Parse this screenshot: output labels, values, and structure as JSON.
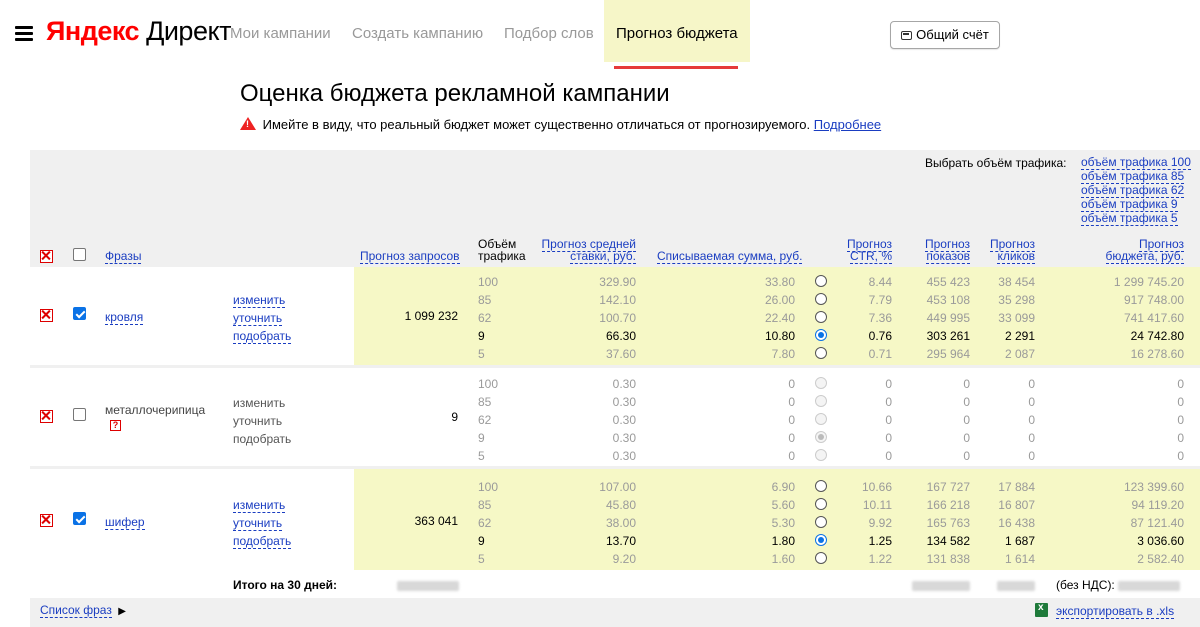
{
  "header": {
    "logo_yandex": "Яндекс",
    "logo_direct": "Директ",
    "nav": [
      "Мои кампании",
      "Создать кампанию",
      "Подбор слов",
      "Прогноз бюджета"
    ],
    "account_button": "Общий счёт"
  },
  "page": {
    "title": "Оценка бюджета рекламной кампании",
    "warning": "Имейте в виду, что реальный бюджет может существенно отличаться от прогнозируемого.",
    "warning_link": "Подробнее"
  },
  "traffic": {
    "label": "Выбрать объём трафика:",
    "options": [
      "объём трафика 100",
      "объём трафика 85",
      "объём трафика 62",
      "объём трафика 9",
      "объём трафика 5"
    ]
  },
  "columns": {
    "phrases": "Фразы",
    "requests": "Прогноз запросов",
    "traffic_1": "Объём",
    "traffic_2": "трафика",
    "bid_1": "Прогноз средней",
    "bid_2": "ставки, руб.",
    "charge": "Списываемая сумма, руб.",
    "ctr_1": "Прогноз",
    "ctr_2": "CTR, %",
    "impr_1": "Прогноз",
    "impr_2": "показов",
    "clicks_1": "Прогноз",
    "clicks_2": "кликов",
    "budget_1": "Прогноз",
    "budget_2": "бюджета, руб."
  },
  "actions": [
    "изменить",
    "уточнить",
    "подобрать"
  ],
  "rows": [
    {
      "phrase": "кровля",
      "requests": "1 099 232",
      "checked": true,
      "volumes": [
        "100",
        "85",
        "62",
        "9",
        "5"
      ],
      "bids": [
        "329.90",
        "142.10",
        "100.70",
        "66.30",
        "37.60"
      ],
      "charges": [
        "33.80",
        "26.00",
        "22.40",
        "10.80",
        "7.80"
      ],
      "ctr": [
        "8.44",
        "7.79",
        "7.36",
        "0.76",
        "0.71"
      ],
      "impressions": [
        "455 423",
        "453 108",
        "449 995",
        "303 261",
        "295 964"
      ],
      "clicks": [
        "38 454",
        "35 298",
        "33 099",
        "2 291",
        "2 087"
      ],
      "budget": [
        "1 299 745.20",
        "917 748.00",
        "741 417.60",
        "24 742.80",
        "16 278.60"
      ],
      "selected": 3
    },
    {
      "phrase": "металлочерипица",
      "requests": "9",
      "checked": false,
      "volumes": [
        "100",
        "85",
        "62",
        "9",
        "5"
      ],
      "bids": [
        "0.30",
        "0.30",
        "0.30",
        "0.30",
        "0.30"
      ],
      "charges": [
        "0",
        "0",
        "0",
        "0",
        "0"
      ],
      "ctr": [
        "0",
        "0",
        "0",
        "0",
        "0"
      ],
      "impressions": [
        "0",
        "0",
        "0",
        "0",
        "0"
      ],
      "clicks": [
        "0",
        "0",
        "0",
        "0",
        "0"
      ],
      "budget": [
        "0",
        "0",
        "0",
        "0",
        "0"
      ],
      "selected": 3
    },
    {
      "phrase": "шифер",
      "requests": "363 041",
      "checked": true,
      "volumes": [
        "100",
        "85",
        "62",
        "9",
        "5"
      ],
      "bids": [
        "107.00",
        "45.80",
        "38.00",
        "13.70",
        "9.20"
      ],
      "charges": [
        "6.90",
        "5.60",
        "5.30",
        "1.80",
        "1.60"
      ],
      "ctr": [
        "10.66",
        "10.11",
        "9.92",
        "1.25",
        "1.22"
      ],
      "impressions": [
        "167 727",
        "166 218",
        "165 763",
        "134 582",
        "131 838"
      ],
      "clicks": [
        "17 884",
        "16 807",
        "16 438",
        "1 687",
        "1 614"
      ],
      "budget": [
        "123 399.60",
        "94 119.20",
        "87 121.40",
        "3 036.60",
        "2 582.40"
      ],
      "selected": 3
    }
  ],
  "totals": {
    "label": "Итого на 30 дней:",
    "vat_label": "(без НДС):"
  },
  "footer": {
    "phrase_list": "Список фраз",
    "export": "экспортировать в .xls"
  }
}
